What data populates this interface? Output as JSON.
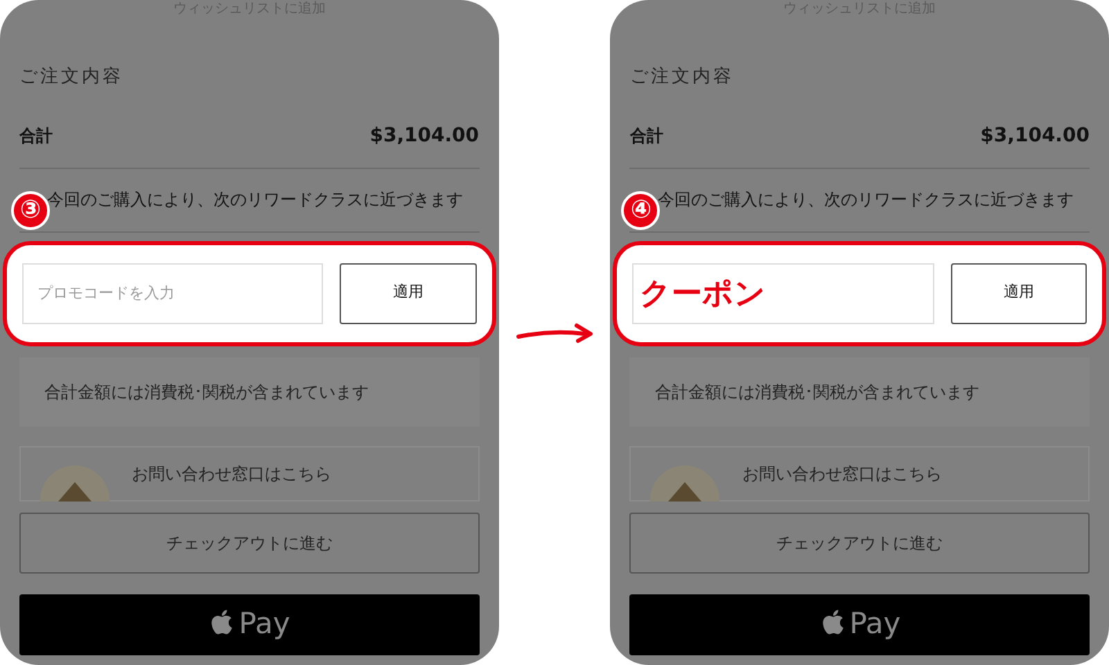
{
  "panels": [
    {
      "step_badge": "③",
      "wishlist": "ウィッシュリストに追加",
      "section_title": "ご注文内容",
      "total_label": "合計",
      "total_value": "$3,104.00",
      "reward_note": "今回のご購入により、次のリワードクラスに近づきます",
      "promo_field": {
        "placeholder": "プロモコードを入力"
      },
      "apply_button": "適用",
      "tax_note": "合計金額には消費税･関税が含まれています",
      "contact_link": "お問い合わせ窓口はこちら",
      "checkout_button": "チェックアウトに進む",
      "pay_button": "Pay"
    },
    {
      "step_badge": "④",
      "wishlist": "ウィッシュリストに追加",
      "section_title": "ご注文内容",
      "total_label": "合計",
      "total_value": "$3,104.00",
      "reward_note": "今回のご購入により、次のリワードクラスに近づきます",
      "promo_field": {
        "value": "クーポン"
      },
      "apply_button": "適用",
      "tax_note": "合計金額には消費税･関税が含まれています",
      "contact_link": "お問い合わせ窓口はこちら",
      "checkout_button": "チェックアウトに進む",
      "pay_button": "Pay"
    }
  ]
}
